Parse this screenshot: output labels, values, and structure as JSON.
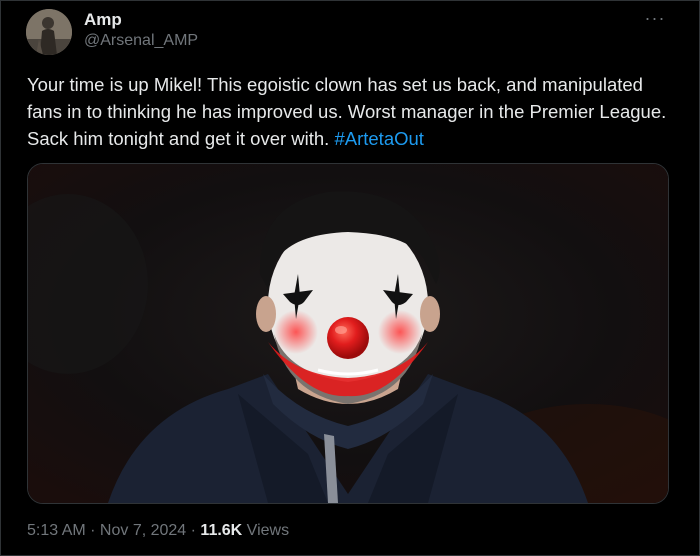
{
  "author": {
    "name": "Amp",
    "handle": "@Arsenal_AMP",
    "avatar_icon": "profile-avatar"
  },
  "menu": {
    "icon": "more-options-icon",
    "glyph": "···"
  },
  "tweet": {
    "text": "Your time is up Mikel!  This egoistic clown has set us back, and manipulated fans in to thinking he has improved us. Worst manager in the Premier League. Sack him tonight and get it over with.",
    "hashtag": "#ArtetaOut"
  },
  "media": {
    "icon": "clown-makeup-photo"
  },
  "meta": {
    "time": "5:13 AM",
    "sep1": " · ",
    "date": "Nov 7, 2024",
    "sep2": " · ",
    "views_count": "11.6K",
    "views_label": " Views"
  },
  "colors": {
    "background": "#000000",
    "text": "#e7e9ea",
    "secondary": "#71767b",
    "link": "#1d9bf0",
    "border": "#2f3336"
  }
}
